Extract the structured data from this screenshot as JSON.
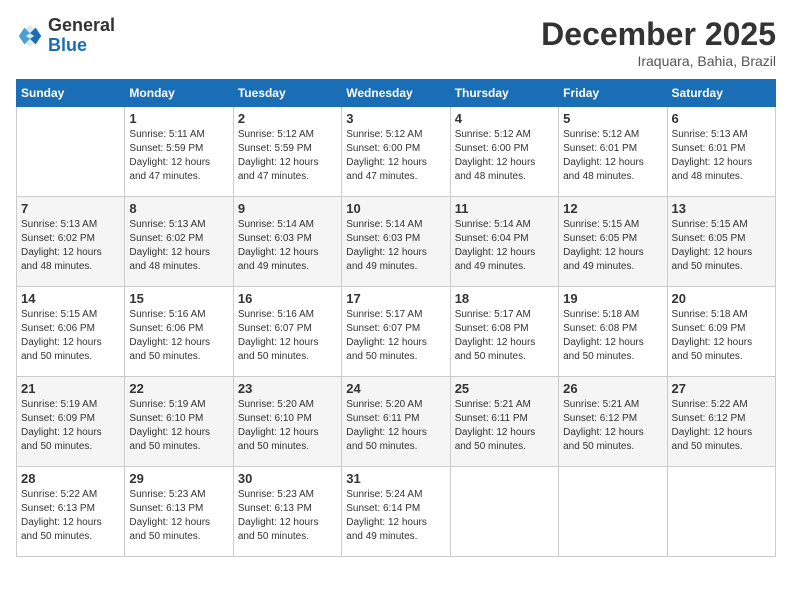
{
  "header": {
    "logo_general": "General",
    "logo_blue": "Blue",
    "month_title": "December 2025",
    "location": "Iraquara, Bahia, Brazil"
  },
  "calendar": {
    "days_of_week": [
      "Sunday",
      "Monday",
      "Tuesday",
      "Wednesday",
      "Thursday",
      "Friday",
      "Saturday"
    ],
    "weeks": [
      [
        {
          "day": "",
          "info": ""
        },
        {
          "day": "1",
          "info": "Sunrise: 5:11 AM\nSunset: 5:59 PM\nDaylight: 12 hours and 47 minutes."
        },
        {
          "day": "2",
          "info": "Sunrise: 5:12 AM\nSunset: 5:59 PM\nDaylight: 12 hours and 47 minutes."
        },
        {
          "day": "3",
          "info": "Sunrise: 5:12 AM\nSunset: 6:00 PM\nDaylight: 12 hours and 47 minutes."
        },
        {
          "day": "4",
          "info": "Sunrise: 5:12 AM\nSunset: 6:00 PM\nDaylight: 12 hours and 48 minutes."
        },
        {
          "day": "5",
          "info": "Sunrise: 5:12 AM\nSunset: 6:01 PM\nDaylight: 12 hours and 48 minutes."
        },
        {
          "day": "6",
          "info": "Sunrise: 5:13 AM\nSunset: 6:01 PM\nDaylight: 12 hours and 48 minutes."
        }
      ],
      [
        {
          "day": "7",
          "info": "Sunrise: 5:13 AM\nSunset: 6:02 PM\nDaylight: 12 hours and 48 minutes."
        },
        {
          "day": "8",
          "info": "Sunrise: 5:13 AM\nSunset: 6:02 PM\nDaylight: 12 hours and 48 minutes."
        },
        {
          "day": "9",
          "info": "Sunrise: 5:14 AM\nSunset: 6:03 PM\nDaylight: 12 hours and 49 minutes."
        },
        {
          "day": "10",
          "info": "Sunrise: 5:14 AM\nSunset: 6:03 PM\nDaylight: 12 hours and 49 minutes."
        },
        {
          "day": "11",
          "info": "Sunrise: 5:14 AM\nSunset: 6:04 PM\nDaylight: 12 hours and 49 minutes."
        },
        {
          "day": "12",
          "info": "Sunrise: 5:15 AM\nSunset: 6:05 PM\nDaylight: 12 hours and 49 minutes."
        },
        {
          "day": "13",
          "info": "Sunrise: 5:15 AM\nSunset: 6:05 PM\nDaylight: 12 hours and 50 minutes."
        }
      ],
      [
        {
          "day": "14",
          "info": "Sunrise: 5:15 AM\nSunset: 6:06 PM\nDaylight: 12 hours and 50 minutes."
        },
        {
          "day": "15",
          "info": "Sunrise: 5:16 AM\nSunset: 6:06 PM\nDaylight: 12 hours and 50 minutes."
        },
        {
          "day": "16",
          "info": "Sunrise: 5:16 AM\nSunset: 6:07 PM\nDaylight: 12 hours and 50 minutes."
        },
        {
          "day": "17",
          "info": "Sunrise: 5:17 AM\nSunset: 6:07 PM\nDaylight: 12 hours and 50 minutes."
        },
        {
          "day": "18",
          "info": "Sunrise: 5:17 AM\nSunset: 6:08 PM\nDaylight: 12 hours and 50 minutes."
        },
        {
          "day": "19",
          "info": "Sunrise: 5:18 AM\nSunset: 6:08 PM\nDaylight: 12 hours and 50 minutes."
        },
        {
          "day": "20",
          "info": "Sunrise: 5:18 AM\nSunset: 6:09 PM\nDaylight: 12 hours and 50 minutes."
        }
      ],
      [
        {
          "day": "21",
          "info": "Sunrise: 5:19 AM\nSunset: 6:09 PM\nDaylight: 12 hours and 50 minutes."
        },
        {
          "day": "22",
          "info": "Sunrise: 5:19 AM\nSunset: 6:10 PM\nDaylight: 12 hours and 50 minutes."
        },
        {
          "day": "23",
          "info": "Sunrise: 5:20 AM\nSunset: 6:10 PM\nDaylight: 12 hours and 50 minutes."
        },
        {
          "day": "24",
          "info": "Sunrise: 5:20 AM\nSunset: 6:11 PM\nDaylight: 12 hours and 50 minutes."
        },
        {
          "day": "25",
          "info": "Sunrise: 5:21 AM\nSunset: 6:11 PM\nDaylight: 12 hours and 50 minutes."
        },
        {
          "day": "26",
          "info": "Sunrise: 5:21 AM\nSunset: 6:12 PM\nDaylight: 12 hours and 50 minutes."
        },
        {
          "day": "27",
          "info": "Sunrise: 5:22 AM\nSunset: 6:12 PM\nDaylight: 12 hours and 50 minutes."
        }
      ],
      [
        {
          "day": "28",
          "info": "Sunrise: 5:22 AM\nSunset: 6:13 PM\nDaylight: 12 hours and 50 minutes."
        },
        {
          "day": "29",
          "info": "Sunrise: 5:23 AM\nSunset: 6:13 PM\nDaylight: 12 hours and 50 minutes."
        },
        {
          "day": "30",
          "info": "Sunrise: 5:23 AM\nSunset: 6:13 PM\nDaylight: 12 hours and 50 minutes."
        },
        {
          "day": "31",
          "info": "Sunrise: 5:24 AM\nSunset: 6:14 PM\nDaylight: 12 hours and 49 minutes."
        },
        {
          "day": "",
          "info": ""
        },
        {
          "day": "",
          "info": ""
        },
        {
          "day": "",
          "info": ""
        }
      ]
    ]
  }
}
